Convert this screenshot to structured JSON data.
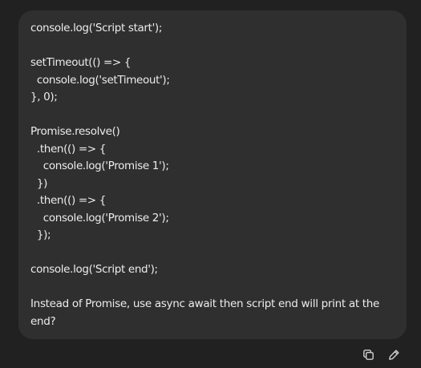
{
  "message": {
    "code_lines": [
      "console.log('Script start');",
      "",
      "setTimeout(() => {",
      "  console.log('setTimeout');",
      "}, 0);",
      "",
      "Promise.resolve()",
      "  .then(() => {",
      "    console.log('Promise 1');",
      "  })",
      "  .then(() => {",
      "    console.log('Promise 2');",
      "  });",
      "",
      "console.log('Script end');",
      ""
    ],
    "question": "Instead of Promise, use async await then script end will print at the end?"
  },
  "actions": {
    "copy_icon": "copy-icon",
    "edit_icon": "pencil-icon"
  },
  "colors": {
    "background": "#212121",
    "bubble": "#2f2f2f",
    "text": "#ececec",
    "icon": "#cfcfcf"
  }
}
